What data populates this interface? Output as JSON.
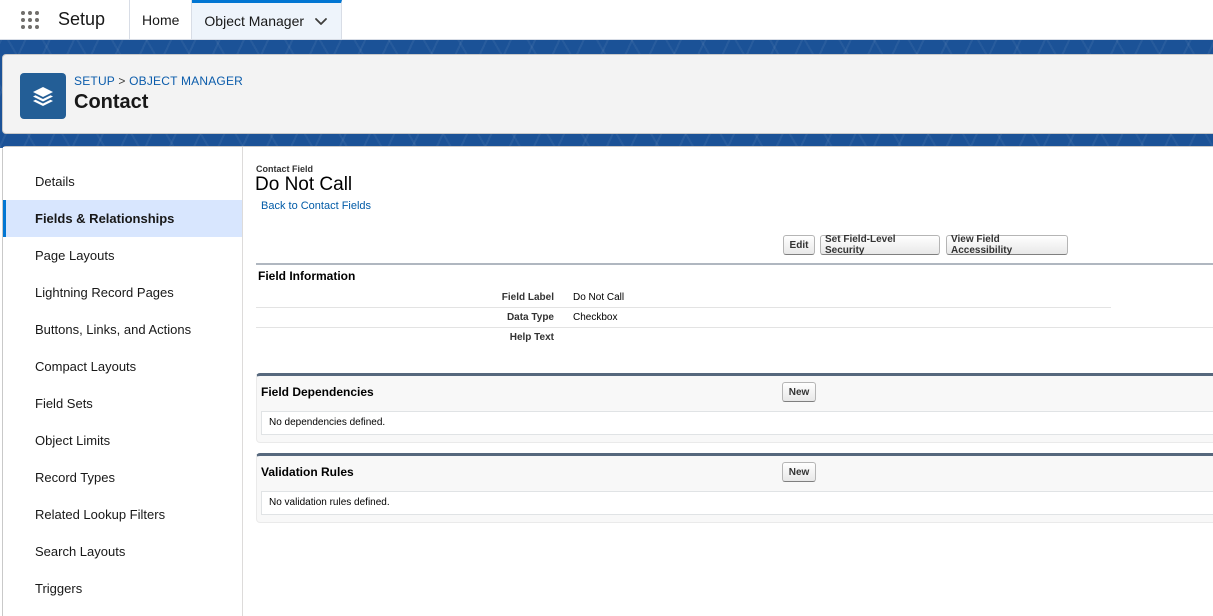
{
  "topnav": {
    "app_name": "Setup",
    "tabs": [
      {
        "label": "Home"
      },
      {
        "label": "Object Manager"
      }
    ]
  },
  "header": {
    "breadcrumb": [
      "SETUP",
      ">",
      "OBJECT MANAGER"
    ],
    "title": "Contact"
  },
  "sidebar": {
    "items": [
      {
        "label": "Details"
      },
      {
        "label": "Fields & Relationships"
      },
      {
        "label": "Page Layouts"
      },
      {
        "label": "Lightning Record Pages"
      },
      {
        "label": "Buttons, Links, and Actions"
      },
      {
        "label": "Compact Layouts"
      },
      {
        "label": "Field Sets"
      },
      {
        "label": "Object Limits"
      },
      {
        "label": "Record Types"
      },
      {
        "label": "Related Lookup Filters"
      },
      {
        "label": "Search Layouts"
      },
      {
        "label": "Triggers"
      }
    ],
    "active_index": 1
  },
  "field": {
    "type_label": "Contact Field",
    "name": "Do Not Call",
    "back_link": "Back to Contact Fields",
    "buttons": {
      "edit": "Edit",
      "fls": "Set Field-Level Security",
      "accessibility": "View Field Accessibility"
    },
    "info_section_title": "Field Information",
    "details": [
      {
        "label": "Field Label",
        "value": "Do Not Call"
      },
      {
        "label": "Data Type",
        "value": "Checkbox"
      },
      {
        "label": "Help Text",
        "value": ""
      }
    ]
  },
  "related_lists": [
    {
      "title": "Field Dependencies",
      "new_label": "New",
      "empty_text": "No dependencies defined."
    },
    {
      "title": "Validation Rules",
      "new_label": "New",
      "empty_text": "No validation rules defined."
    }
  ],
  "colors": {
    "brand_blue": "#1b5297",
    "active_tab_border": "#0176d3",
    "active_sidebar_bg": "#d8e6fe",
    "link": "#015ba7",
    "object_icon_bg": "#235e96"
  },
  "icons": {
    "app_launcher": "waffle-icon",
    "tab_menu": "chevron-down-icon",
    "object": "layers-icon"
  }
}
